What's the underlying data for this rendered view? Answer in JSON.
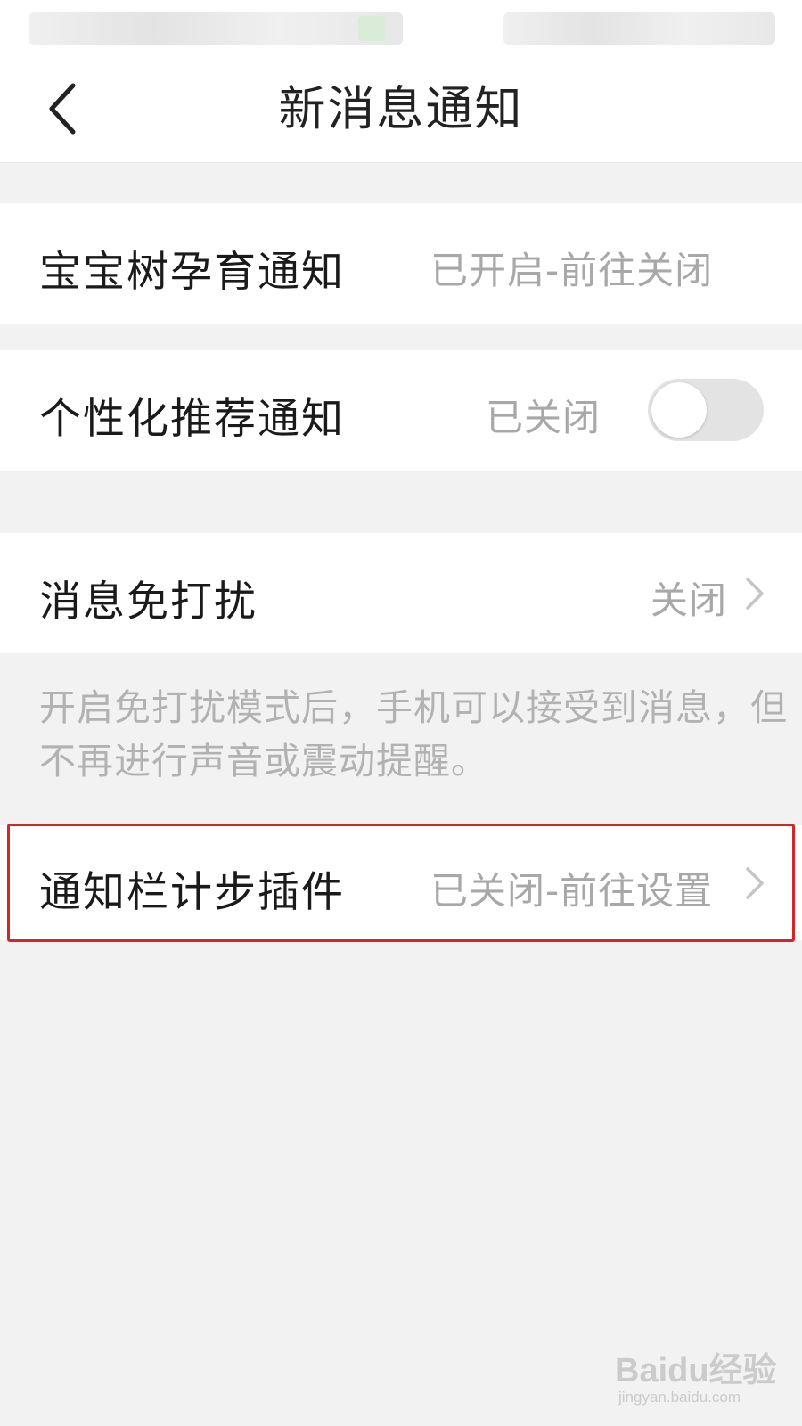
{
  "header": {
    "title": "新消息通知"
  },
  "settings": {
    "pregnancy": {
      "label": "宝宝树孕育通知",
      "value": "已开启-前往关闭"
    },
    "personalized": {
      "label": "个性化推荐通知",
      "value": "已关闭",
      "enabled": false
    },
    "dnd": {
      "label": "消息免打扰",
      "value": "关闭",
      "note": "开启免打扰模式后，手机可以接受到消息，但不再进行声音或震动提醒。"
    },
    "step_widget": {
      "label": "通知栏计步插件",
      "value": "已关闭-前往设置"
    }
  },
  "watermark": {
    "main": "Baidu经验",
    "sub": "jingyan.baidu.com"
  },
  "colors": {
    "highlight": "#d32626",
    "secondary_text": "#a8a8a8",
    "background": "#f2f2f2"
  }
}
